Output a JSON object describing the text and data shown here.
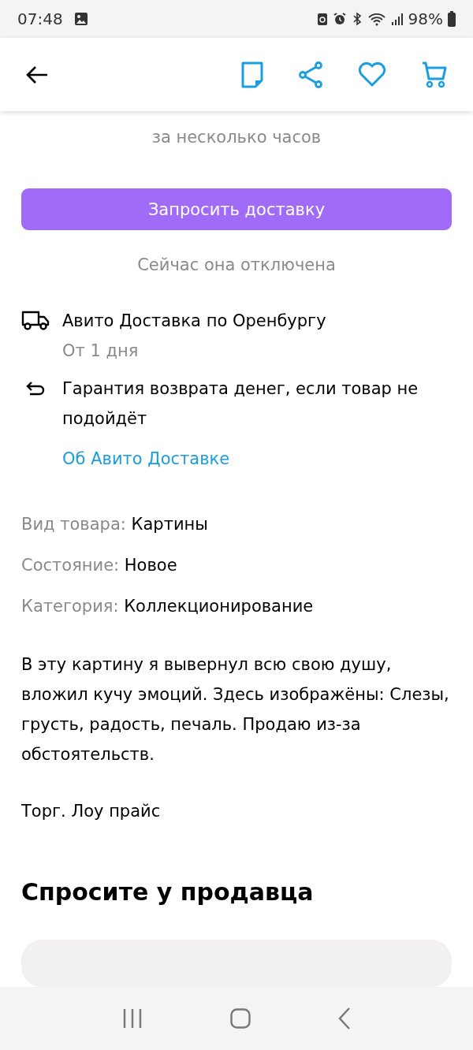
{
  "status_bar": {
    "time": "07:48",
    "battery": "98%"
  },
  "reply_time": "за несколько часов",
  "delivery_button": {
    "label": "Запросить доставку"
  },
  "delivery_note": "Сейчас она отключена",
  "features": [
    {
      "kind": "delivery",
      "title": "Авито Доставка по Оренбургу",
      "subtitle": "От 1 дня"
    },
    {
      "kind": "return",
      "title": "Гарантия возврата денег, если товар не подойдёт"
    }
  ],
  "delivery_link": "Об Авито Доставке",
  "params": [
    {
      "label": "Вид товара:",
      "value": "Картины"
    },
    {
      "label": "Состояние:",
      "value": "Новое"
    },
    {
      "label": "Категория:",
      "value": "Коллекционирование"
    }
  ],
  "description": [
    "В эту картину я вывернул всю свою душу, вложил кучу эмоций. Здесь изображёны: Слезы, грусть, радость, печаль. Продаю из-за обстоятельств.",
    "Торг. Лоу прайс"
  ],
  "ask_heading": "Спросите у продавца"
}
